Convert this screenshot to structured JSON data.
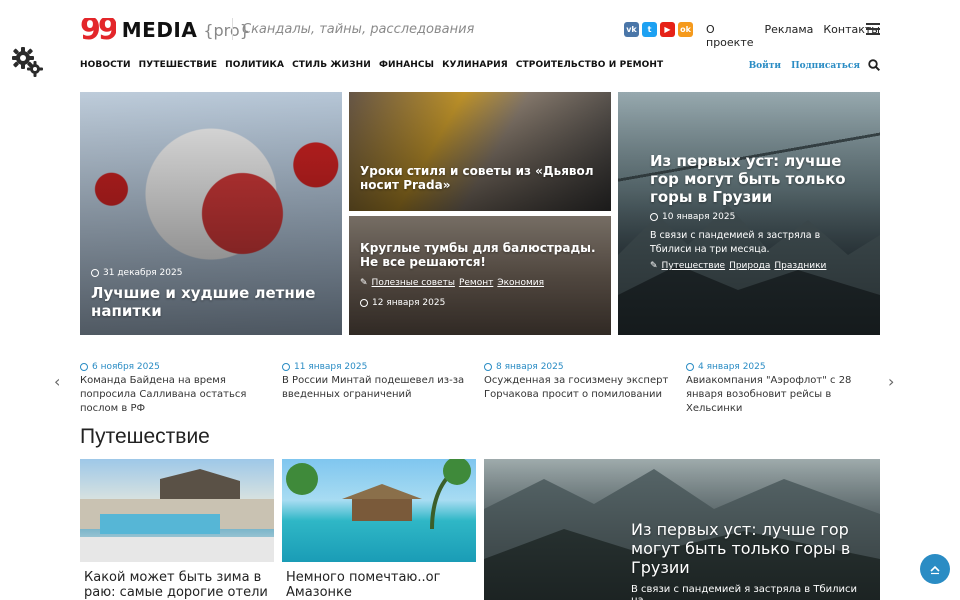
{
  "brand": {
    "quote": "99",
    "name": "MEDIA",
    "suffix": "{pro}",
    "tagline": "Скандалы, тайны, расследования"
  },
  "socials": [
    {
      "name": "vk-icon",
      "glyph": "vk"
    },
    {
      "name": "twitter-icon",
      "glyph": "t"
    },
    {
      "name": "youtube-icon",
      "glyph": "▶"
    },
    {
      "name": "odnoklassniki-icon",
      "glyph": "ok"
    }
  ],
  "top_links": [
    "О проекте",
    "Реклама",
    "Контакты"
  ],
  "nav": [
    "НОВОСТИ",
    "ПУТЕШЕСТВИЕ",
    "ПОЛИТИКА",
    "СТИЛЬ ЖИЗНИ",
    "ФИНАНСЫ",
    "КУЛИНАРИЯ",
    "СТРОИТЕЛЬСТВО И РЕМОНТ"
  ],
  "auth": {
    "login": "Войти",
    "signup": "Подписаться"
  },
  "hero": {
    "left": {
      "date": "31 декабря 2025",
      "title": "Лучшие и худшие летние напитки"
    },
    "mid_top": {
      "title": "Уроки стиля и советы из «Дьявол носит Prada»"
    },
    "mid_bottom": {
      "title": "Круглые тумбы для балюстрады. Не все решаются!",
      "tags": [
        "Полезные советы",
        "Ремонт",
        "Экономия"
      ],
      "date": "12 января 2025"
    },
    "right": {
      "title": "Из первых уст: лучше гор могут быть только горы в Грузии",
      "date": "10 января 2025",
      "excerpt": "В связи с пандемией я застряла в Тбилиси на три месяца.",
      "tags": [
        "Путешествие",
        "Природа",
        "Праздники"
      ]
    }
  },
  "ticker": [
    {
      "date": "6 ноября 2025",
      "text": "Команда Байдена на время попросила Салливана остаться послом в РФ"
    },
    {
      "date": "11 января 2025",
      "text": "В России Минтай подешевел из-за введенных ограничений"
    },
    {
      "date": "8 января 2025",
      "text": "Осужденная за госизмену эксперт Горчакова просит о помиловании"
    },
    {
      "date": "4 января 2025",
      "text": "Авиакомпания \"Аэрофлот\" с 28 января возобновит рейсы в Хельсинки"
    }
  ],
  "section": {
    "title": "Путешествие",
    "cards": [
      {
        "title": "Какой может быть зима в раю: самые дорогие отели"
      },
      {
        "title": "Немного помечтаю..ог Амазонке"
      }
    ],
    "big": {
      "title": "Из первых уст: лучше гор могут быть только горы в Грузии",
      "excerpt": "В связи с пандемией я застряла в Тбилиси на"
    }
  },
  "colors": {
    "accent": "#2a8cc4",
    "brand_red": "#e3262a"
  }
}
